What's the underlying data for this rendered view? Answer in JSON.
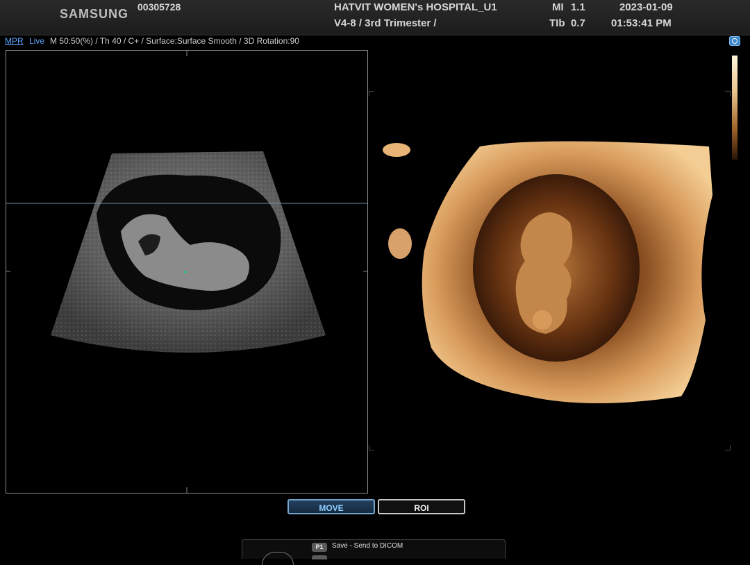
{
  "header": {
    "brand": "SAMSUNG",
    "patient_id": "00305728",
    "hospital": "HATVIT WOMEN's HOSPITAL_U1",
    "preset": "V4-8 / 3rd Trimester /",
    "mi_label": "MI",
    "mi_value": "1.1",
    "tib_label": "TIb",
    "tib_value": "0.7",
    "date": "2023-01-09",
    "time": "01:53:41 PM"
  },
  "infobar": {
    "mode": "MPR",
    "live": "Live",
    "params": "M 50:50(%) / Th 40 / C+ / Surface:Surface Smooth / 3D Rotation:90"
  },
  "icons": {
    "camera": "camera-icon",
    "colorbar": "render-colorbar"
  },
  "buttons": {
    "move": "MOVE",
    "roi": "ROI"
  },
  "footer": {
    "p1_label": "P1",
    "p1_action": "Save - Send to DICOM"
  },
  "colors": {
    "accent_blue": "#5aa7ff",
    "render_tint": "#c98a4a",
    "background": "#000000"
  }
}
